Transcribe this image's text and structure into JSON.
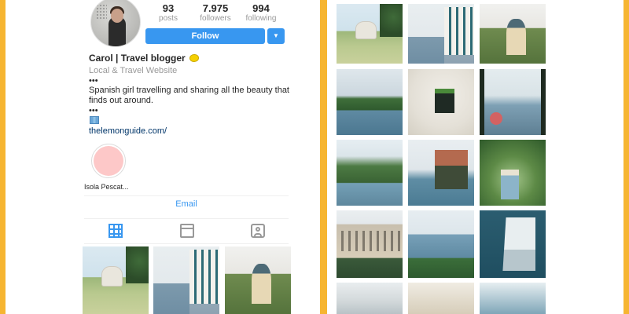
{
  "profile": {
    "name": "Carol | Travel blogger",
    "category": "Local & Travel Website",
    "bio_lines": [
      "•••",
      "Spanish girl travelling and sharing all the beauty that",
      "finds out around.",
      "•••"
    ],
    "link": "thelemonguide.com/"
  },
  "stats": [
    {
      "value": "93",
      "label": "posts"
    },
    {
      "value": "7.975",
      "label": "followers"
    },
    {
      "value": "994",
      "label": "following"
    }
  ],
  "actions": {
    "follow_label": "Follow",
    "dropdown_label": "▼",
    "email_label": "Email"
  },
  "highlights": [
    {
      "label": "Isola Pescat..."
    }
  ],
  "tabs": [
    {
      "name": "grid",
      "icon": "grid-icon",
      "active": true
    },
    {
      "name": "feed",
      "icon": "feed-icon",
      "active": false
    },
    {
      "name": "tagged",
      "icon": "tagged-icon",
      "active": false
    }
  ],
  "colors": {
    "accent": "#3897f0",
    "frame": "#f6b531",
    "link": "#003569"
  },
  "left_grid_photos": [
    "chapel",
    "blue-house",
    "dome"
  ],
  "right_grid_photos": [
    "chapel",
    "blue-house",
    "dome",
    "lake",
    "wall-mailbox",
    "terrace",
    "mountain-lake",
    "villa-rock",
    "garden-door",
    "hotel",
    "waterfront",
    "boat",
    "street",
    "arches",
    "bay"
  ]
}
